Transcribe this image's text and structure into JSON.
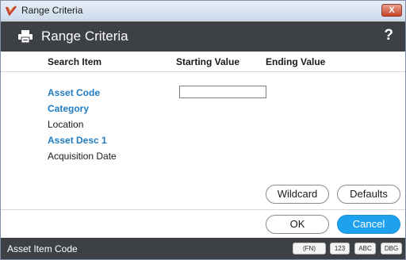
{
  "window": {
    "title": "Range Criteria",
    "close_label": "X",
    "app_icon": "checkmark-logo-icon"
  },
  "header": {
    "title": "Range Criteria",
    "icon": "printer-icon",
    "help_label": "?"
  },
  "columns": {
    "search_item": "Search Item",
    "starting_value": "Starting Value",
    "ending_value": "Ending Value"
  },
  "rows": [
    {
      "label": "Asset Code",
      "style": "link"
    },
    {
      "label": "Category",
      "style": "link"
    },
    {
      "label": "Location",
      "style": "plain"
    },
    {
      "label": "Asset Desc 1",
      "style": "link"
    },
    {
      "label": "Acquisition Date",
      "style": "plain"
    }
  ],
  "starting_value_input": {
    "value": ""
  },
  "buttons": {
    "wildcard": "Wildcard",
    "defaults": "Defaults",
    "ok": "OK",
    "cancel": "Cancel"
  },
  "status": {
    "text": "Asset Item Code",
    "badges": [
      "(FN)",
      "123",
      "ABC",
      "DBG"
    ]
  },
  "colors": {
    "header_bg": "#3d4044",
    "link": "#1f7cc2",
    "primary": "#1ea2f0"
  }
}
